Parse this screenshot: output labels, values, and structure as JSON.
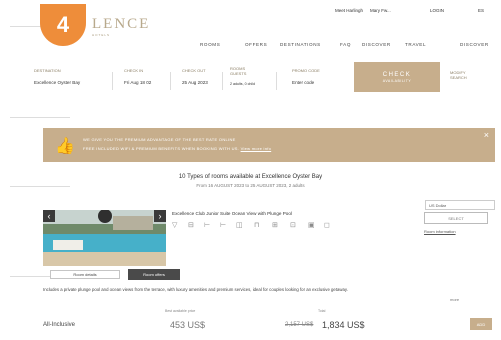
{
  "step_badge": "4",
  "topbar": {
    "links": [
      "Meet Harlingh",
      "Mary Fw...",
      "LOGIN",
      "ES"
    ]
  },
  "logo": {
    "text": "LENCE",
    "sub": "HOTELS"
  },
  "nav": [
    "ROOMS",
    "OFFERS",
    "DESTINATIONS",
    "FAQ",
    "DISCOVER",
    "TRAVEL",
    "DISCOVER"
  ],
  "search": {
    "destination_label": "DESTINATION",
    "destination_value": "Excellence Oyster Bay",
    "checkin_label": "CHECK IN",
    "checkin_value": "Fri Aug 18 02",
    "checkout_label": "CHECK OUT",
    "checkout_value": "25 Aug 2023",
    "rooms_label": "ROOMS GUESTS",
    "rooms_value": "2 adults, 0 child",
    "promo_label": "PROMO CODE",
    "promo_value": "Enter code",
    "check_button": "CHECK",
    "check_button_sub": "AVAILABILITY",
    "modify_label": "MODIFY SEARCH"
  },
  "promo_banner": {
    "line1": "WE GIVE YOU THE PREMIUM ADVANTAGE OF THE BEST RATE ONLINE",
    "line2": "FREE INCLUDED WIFI & PREMIUM BENEFITS WHEN BOOKING WITH US.",
    "link": "View more info"
  },
  "availability": {
    "title": "10 Types of rooms available at Excellence Oyster Bay",
    "subtitle": "From 16 AUGUST 2023 to 25 AUGUST 2023, 2 adults"
  },
  "room": {
    "title": "Excellence Club Junior Suite Ocean View with Plunge Pool",
    "amenities": [
      "wifi-icon",
      "bed-icon",
      "bed-icon",
      "bed-icon",
      "shower-icon",
      "bath-icon",
      "plug-icon",
      "tv-icon",
      "phone-icon",
      "safe-icon"
    ],
    "currency": "US Dollar",
    "select_button": "SELECT",
    "info_link": "Room information",
    "tab_details": "Room details",
    "tab_rates": "Room offers",
    "description": "Includes a private plunge pool and ocean views from the terrace, with luxury amenities and premium services, ideal for couples looking for an exclusive getaway.",
    "more": "more"
  },
  "rate": {
    "col1_header": "Best available price",
    "col2_header": "Total",
    "bed": "All-Inclusive",
    "price1": "453 US$",
    "old_price": "2,157 US$",
    "price2": "1,834 US$",
    "add_button": "ADD"
  }
}
